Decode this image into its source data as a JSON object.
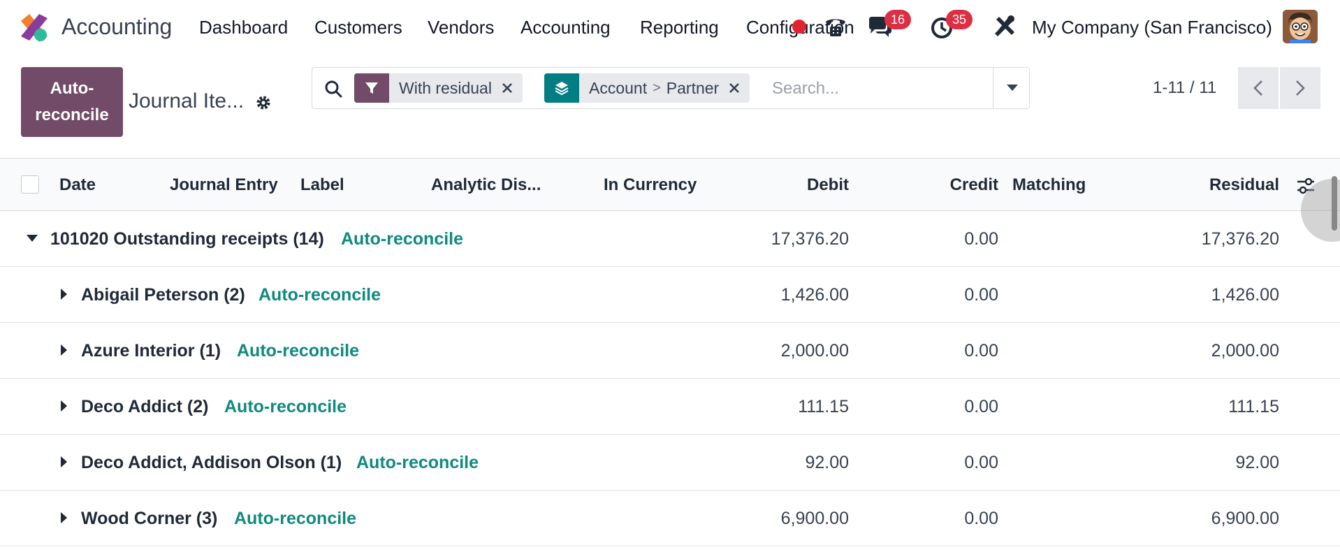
{
  "app": {
    "name": "Accounting"
  },
  "nav": {
    "items": [
      "Dashboard",
      "Customers",
      "Vendors",
      "Accounting",
      "Reporting",
      "Configuration"
    ]
  },
  "systray": {
    "messages_count": "16",
    "activities_count": "35",
    "company": "My Company (San Francisco)"
  },
  "control": {
    "primary_button": "Auto-reconcile",
    "breadcrumb": "Journal Ite...",
    "facets": [
      {
        "label": "With residual",
        "icon": "filter-icon",
        "color": "#714b67"
      },
      {
        "label": "Account",
        "sep": ">",
        "label2": "Partner",
        "icon": "layers-icon",
        "color": "#017e84"
      }
    ],
    "search_placeholder": "Search...",
    "pager": "1-11 / 11"
  },
  "table": {
    "columns": {
      "date": "Date",
      "journal_entry": "Journal Entry",
      "label": "Label",
      "analytic": "Analytic Dis...",
      "in_currency": "In Currency",
      "debit": "Debit",
      "credit": "Credit",
      "matching": "Matching",
      "residual": "Residual"
    },
    "group": {
      "name": "101020 Outstanding receipts (14)",
      "action": "Auto-reconcile",
      "debit": "17,376.20",
      "credit": "0.00",
      "residual": "17,376.20"
    },
    "subgroups": [
      {
        "name": "Abigail Peterson (2)",
        "action": "Auto-reconcile",
        "debit": "1,426.00",
        "credit": "0.00",
        "residual": "1,426.00"
      },
      {
        "name": "Azure Interior (1)",
        "action": "Auto-reconcile",
        "debit": "2,000.00",
        "credit": "0.00",
        "residual": "2,000.00"
      },
      {
        "name": "Deco Addict (2)",
        "action": "Auto-reconcile",
        "debit": "111.15",
        "credit": "0.00",
        "residual": "111.15"
      },
      {
        "name": "Deco Addict, Addison Olson (1)",
        "action": "Auto-reconcile",
        "debit": "92.00",
        "credit": "0.00",
        "residual": "92.00"
      },
      {
        "name": "Wood Corner (3)",
        "action": "Auto-reconcile",
        "debit": "6,900.00",
        "credit": "0.00",
        "residual": "6,900.00"
      }
    ]
  },
  "colors": {
    "primary": "#714b67",
    "link": "#0f8a7e",
    "badge": "#dc2f43",
    "teal": "#017e84"
  }
}
